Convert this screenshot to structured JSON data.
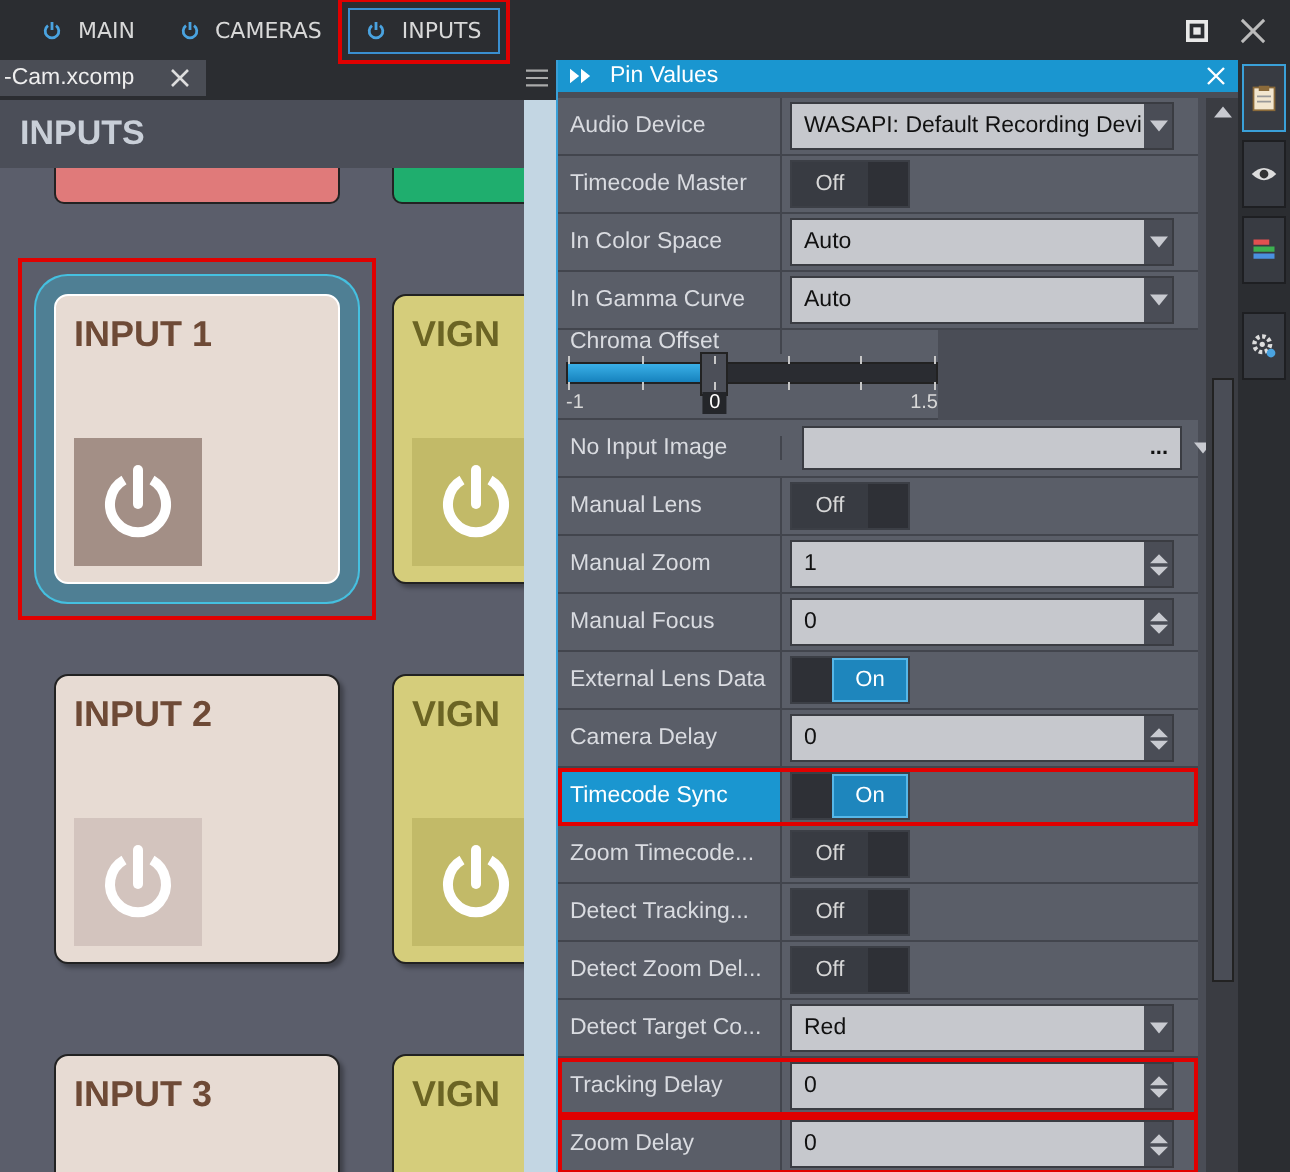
{
  "top_tabs": [
    {
      "label": "MAIN",
      "selected": false,
      "highlighted": false
    },
    {
      "label": "CAMERAS",
      "selected": false,
      "highlighted": false
    },
    {
      "label": "INPUTS",
      "selected": true,
      "highlighted": true
    }
  ],
  "document_tab": {
    "label": "-Cam.xcomp"
  },
  "inputs_panel": {
    "title": "INPUTS",
    "tiles": [
      {
        "kind": "partial",
        "color": "#e07a7a"
      },
      {
        "kind": "partial",
        "color": "#1fae6e"
      },
      {
        "kind": "input",
        "title": "INPUT 1",
        "selected": true,
        "highlighted": true
      },
      {
        "kind": "vignette",
        "title": "VIGN",
        "selected": false,
        "highlighted": false
      },
      {
        "kind": "input",
        "title": "INPUT 2",
        "selected": false,
        "highlighted": false
      },
      {
        "kind": "vignette",
        "title": "VIGN",
        "selected": false,
        "highlighted": false
      },
      {
        "kind": "input",
        "title": "INPUT 3",
        "selected": false,
        "highlighted": false
      },
      {
        "kind": "vignette",
        "title": "VIGN",
        "selected": false,
        "highlighted": false
      }
    ]
  },
  "pin_values": {
    "title": "Pin Values",
    "rows": [
      {
        "label": "Audio Device",
        "kind": "dropdown",
        "value": "WASAPI: Default Recording Devi",
        "selected": false,
        "highlighted": false
      },
      {
        "label": "Timecode Master",
        "kind": "toggle",
        "on": false,
        "text": "Off",
        "selected": false,
        "highlighted": false
      },
      {
        "label": "In Color Space",
        "kind": "dropdown",
        "value": "Auto",
        "selected": false,
        "highlighted": false
      },
      {
        "label": "In Gamma Curve",
        "kind": "dropdown",
        "value": "Auto",
        "selected": false,
        "highlighted": false
      },
      {
        "label": "Chroma Offset",
        "kind": "slider",
        "level": 0.4,
        "min": "-1",
        "reading": "0",
        "max": "1.5",
        "selected": false,
        "highlighted": false
      },
      {
        "label": "No Input Image",
        "kind": "file",
        "button": "...",
        "selected": false,
        "highlighted": false
      },
      {
        "label": "Manual Lens",
        "kind": "toggle",
        "on": false,
        "text": "Off",
        "selected": false,
        "highlighted": false
      },
      {
        "label": "Manual Zoom",
        "kind": "number",
        "value": "1",
        "selected": false,
        "highlighted": false
      },
      {
        "label": "Manual Focus",
        "kind": "number",
        "value": "0",
        "selected": false,
        "highlighted": false
      },
      {
        "label": "External Lens Data",
        "kind": "toggle",
        "on": true,
        "text": "On",
        "selected": false,
        "highlighted": false
      },
      {
        "label": "Camera Delay",
        "kind": "number",
        "value": "0",
        "selected": false,
        "highlighted": false
      },
      {
        "label": "Timecode Sync",
        "kind": "toggle",
        "on": true,
        "text": "On",
        "selected": true,
        "highlighted": true
      },
      {
        "label": "Zoom Timecode...",
        "kind": "toggle",
        "on": false,
        "text": "Off",
        "selected": false,
        "highlighted": false
      },
      {
        "label": "Detect Tracking...",
        "kind": "toggle",
        "on": false,
        "text": "Off",
        "selected": false,
        "highlighted": false
      },
      {
        "label": "Detect Zoom Del...",
        "kind": "toggle",
        "on": false,
        "text": "Off",
        "selected": false,
        "highlighted": false
      },
      {
        "label": "Detect Target Co...",
        "kind": "dropdown",
        "value": "Red",
        "selected": false,
        "highlighted": false
      },
      {
        "label": "Tracking Delay",
        "kind": "number",
        "value": "0",
        "selected": false,
        "highlighted": true
      },
      {
        "label": "Zoom Delay",
        "kind": "number",
        "value": "0",
        "selected": false,
        "highlighted": true
      }
    ]
  }
}
